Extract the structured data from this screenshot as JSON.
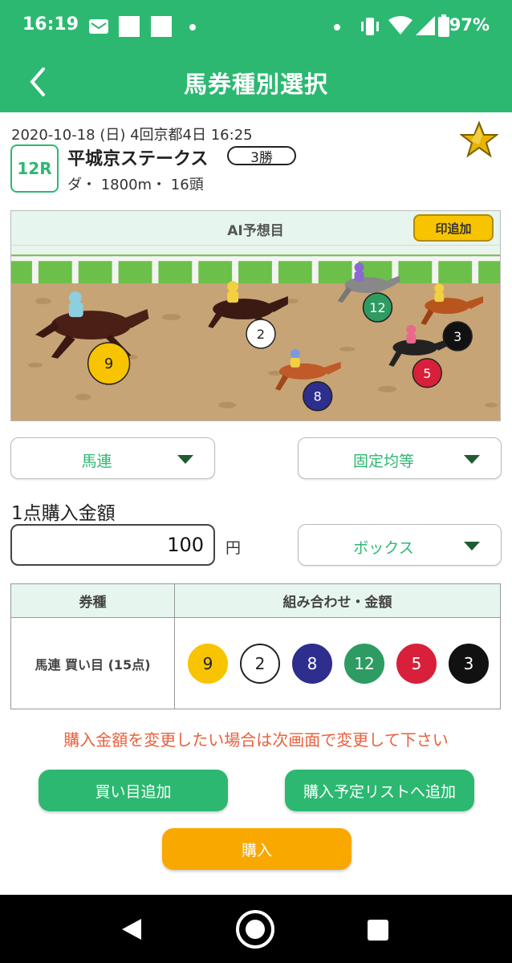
{
  "status_bar": {
    "time": "16:19",
    "battery": "97%",
    "icons": [
      "message-icon",
      "square-icon",
      "square-icon",
      "dot-icon",
      "dot-icon",
      "vibrate-icon",
      "wifi-icon",
      "signal-icon",
      "battery-icon"
    ]
  },
  "header": {
    "title": "馬券種別選択",
    "back_icon": "chevron-left-icon"
  },
  "race": {
    "date_line": "2020-10-18 (日)  4回京都4日  16:25",
    "race_no": "12R",
    "name": "平城京ステークス",
    "class": "3勝",
    "detail": "ダ・ 1800m・ 16頭",
    "favorite_icon": "star-icon"
  },
  "ai": {
    "label": "AI予想目",
    "add_mark_label": "印追加",
    "horses": [
      {
        "no": "9",
        "color": "#f8c400",
        "text_color": "#222"
      },
      {
        "no": "2",
        "color": "#ffffff",
        "text_color": "#222"
      },
      {
        "no": "8",
        "color": "#2e2e8f",
        "text_color": "#ffffff"
      },
      {
        "no": "12",
        "color": "#2e9b63",
        "text_color": "#ffffff"
      },
      {
        "no": "5",
        "color": "#d8203a",
        "text_color": "#ffffff"
      },
      {
        "no": "3",
        "color": "#111111",
        "text_color": "#ffffff"
      }
    ]
  },
  "bet_type": {
    "selected": "馬連"
  },
  "distribution": {
    "selected": "固定均等"
  },
  "amount": {
    "label": "1点購入金額",
    "value": "100",
    "unit": "円"
  },
  "method": {
    "selected": "ボックス"
  },
  "table": {
    "header_type": "券種",
    "header_combo": "組み合わせ・金額",
    "row_label": "馬連 買い目 (15点)",
    "balls": [
      {
        "no": "9",
        "color": "#f8c400",
        "text_color": "#222",
        "border": "#f8c400"
      },
      {
        "no": "2",
        "color": "#ffffff",
        "text_color": "#222",
        "border": "#222222"
      },
      {
        "no": "8",
        "color": "#2e2e8f",
        "text_color": "#ffffff",
        "border": "#2e2e8f"
      },
      {
        "no": "12",
        "color": "#2e9b63",
        "text_color": "#ffffff",
        "border": "#2e9b63"
      },
      {
        "no": "5",
        "color": "#d8203a",
        "text_color": "#ffffff",
        "border": "#d8203a"
      },
      {
        "no": "3",
        "color": "#111111",
        "text_color": "#ffffff",
        "border": "#111111"
      }
    ]
  },
  "notice": "購入金額を変更したい場合は次画面で変更して下さい",
  "buttons": {
    "add_bet": "買い目追加",
    "add_to_list": "購入予定リストへ追加",
    "purchase": "購入"
  },
  "nav": {
    "back": "back-triangle-icon",
    "home": "home-circle-icon",
    "recent": "recent-square-icon"
  }
}
